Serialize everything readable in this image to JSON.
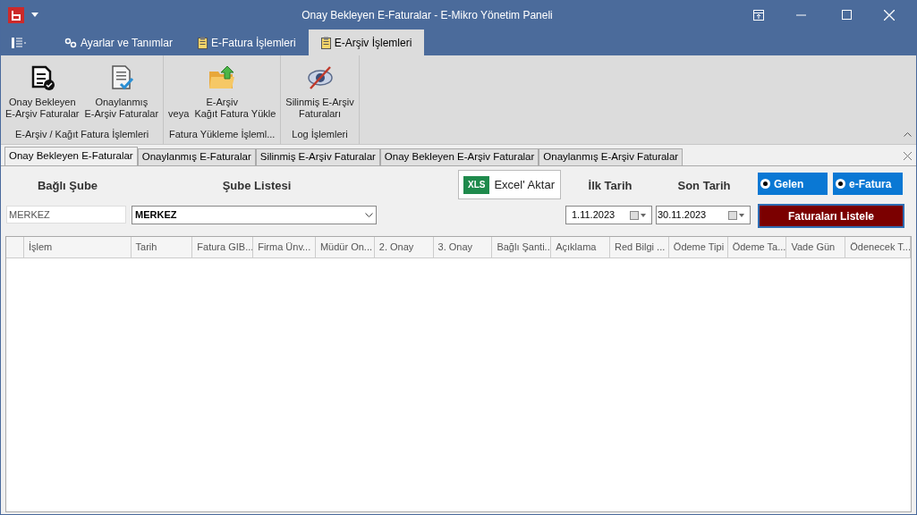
{
  "window": {
    "title": "Onay Bekleyen E-Faturalar - E-Mikro Yönetim Paneli"
  },
  "ribbon_tabs": [
    {
      "label": "Ayarlar ve Tanımlar",
      "kind": "gears",
      "selected": false
    },
    {
      "label": "E-Fatura İşlemleri",
      "kind": "clipboard",
      "selected": false
    },
    {
      "label": "E-Arşiv İşlemleri",
      "kind": "clipboard",
      "selected": true
    }
  ],
  "ribbon_groups": [
    {
      "label": "E-Arşiv / Kağıt Fatura İşlemleri",
      "buttons": [
        {
          "lines": [
            "Onay Bekleyen",
            "E-Arşiv Faturalar"
          ],
          "kind": "pending"
        },
        {
          "lines": [
            "Onaylanmış",
            "E-Arşiv Faturalar"
          ],
          "kind": "approved"
        }
      ]
    },
    {
      "label": "Fatura Yükleme İşleml...",
      "buttons": [
        {
          "lines": [
            "E-Arşiv",
            "veya  Kağıt Fatura Yükle"
          ],
          "kind": "upload"
        }
      ]
    },
    {
      "label": "Log İşlemleri",
      "buttons": [
        {
          "lines": [
            "Silinmiş E-Arşiv",
            "Faturaları"
          ],
          "kind": "deleted"
        }
      ]
    }
  ],
  "document_tabs": [
    {
      "label": "Onay Bekleyen E-Faturalar",
      "selected": true
    },
    {
      "label": "Onaylanmış E-Faturalar",
      "selected": false
    },
    {
      "label": "Silinmiş E-Arşiv Faturalar",
      "selected": false
    },
    {
      "label": "Onay Bekleyen E-Arşiv Faturalar",
      "selected": false
    },
    {
      "label": "Onaylanmış E-Arşiv Faturalar",
      "selected": false
    }
  ],
  "form": {
    "branch_label": "Bağlı Şube",
    "branch_value": "MERKEZ",
    "branch_list_label": "Şube Listesi",
    "branch_list_value": "MERKEZ",
    "excel_button": "Excel' Aktar",
    "excel_icon_text": "XLS",
    "start_date_label": "İlk Tarih",
    "start_date": "1.11.2023",
    "end_date_label": "Son Tarih",
    "end_date": "30.11.2023",
    "radios": [
      {
        "label": "Gelen",
        "checked": true
      },
      {
        "label": "e-Fatura",
        "checked": true
      }
    ],
    "list_button": "Faturaları Listele"
  },
  "table": {
    "columns": [
      "İşlem",
      "Tarih",
      "Fatura GIB...",
      "Firma Ünv...",
      "Müdür On...",
      "2. Onay",
      "3. Onay",
      "Bağlı Şanti...",
      "Açıklama",
      "Red Bilgi ...",
      "Ödeme Tipi",
      "Ödeme Ta...",
      "Vade Gün",
      "Ödenecek T..."
    ]
  }
}
